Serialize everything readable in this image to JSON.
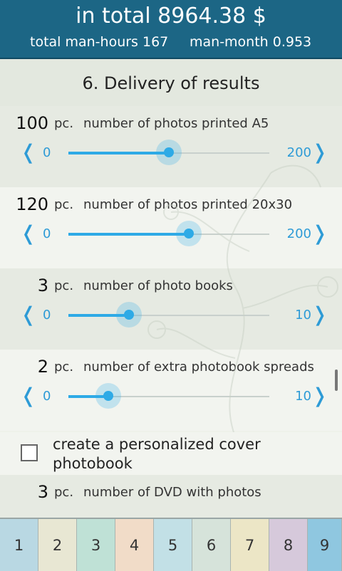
{
  "header": {
    "total": "in total 8964.38 $",
    "man_hours": "total man-hours 167",
    "man_month": "man-month 0.953"
  },
  "section": {
    "title": "6. Delivery of results"
  },
  "sliders": [
    {
      "qty": "100",
      "unit": "pc.",
      "label": "number of photos printed A5",
      "min": "0",
      "max": "200",
      "value": 100,
      "fraction": 0.5
    },
    {
      "qty": "120",
      "unit": "pc.",
      "label": "number of photos printed 20x30",
      "min": "0",
      "max": "200",
      "value": 120,
      "fraction": 0.6
    },
    {
      "qty": "3",
      "unit": "pc.",
      "label": "number of photo books",
      "min": "0",
      "max": "10",
      "value": 3,
      "fraction": 0.3
    },
    {
      "qty": "2",
      "unit": "pc.",
      "label": "number of extra photobook spreads",
      "min": "0",
      "max": "10",
      "value": 2,
      "fraction": 0.2
    }
  ],
  "checkbox": {
    "label": "create a personalized cover photobook",
    "checked": false
  },
  "last_row": {
    "qty": "3",
    "unit": "pc.",
    "label": "number of DVD with photos"
  },
  "arrows": {
    "left": "❬",
    "right": "❭"
  },
  "tabs": [
    {
      "label": "1",
      "color": "#b9d8e3"
    },
    {
      "label": "2",
      "color": "#e8e7d3"
    },
    {
      "label": "3",
      "color": "#bfe1d6"
    },
    {
      "label": "4",
      "color": "#f1dcc8"
    },
    {
      "label": "5",
      "color": "#c2e0e6"
    },
    {
      "label": "6",
      "color": "#d6e3da"
    },
    {
      "label": "7",
      "color": "#ece6c6"
    },
    {
      "label": "8",
      "color": "#d6c9db"
    },
    {
      "label": "9",
      "color": "#8fc7e0"
    }
  ]
}
